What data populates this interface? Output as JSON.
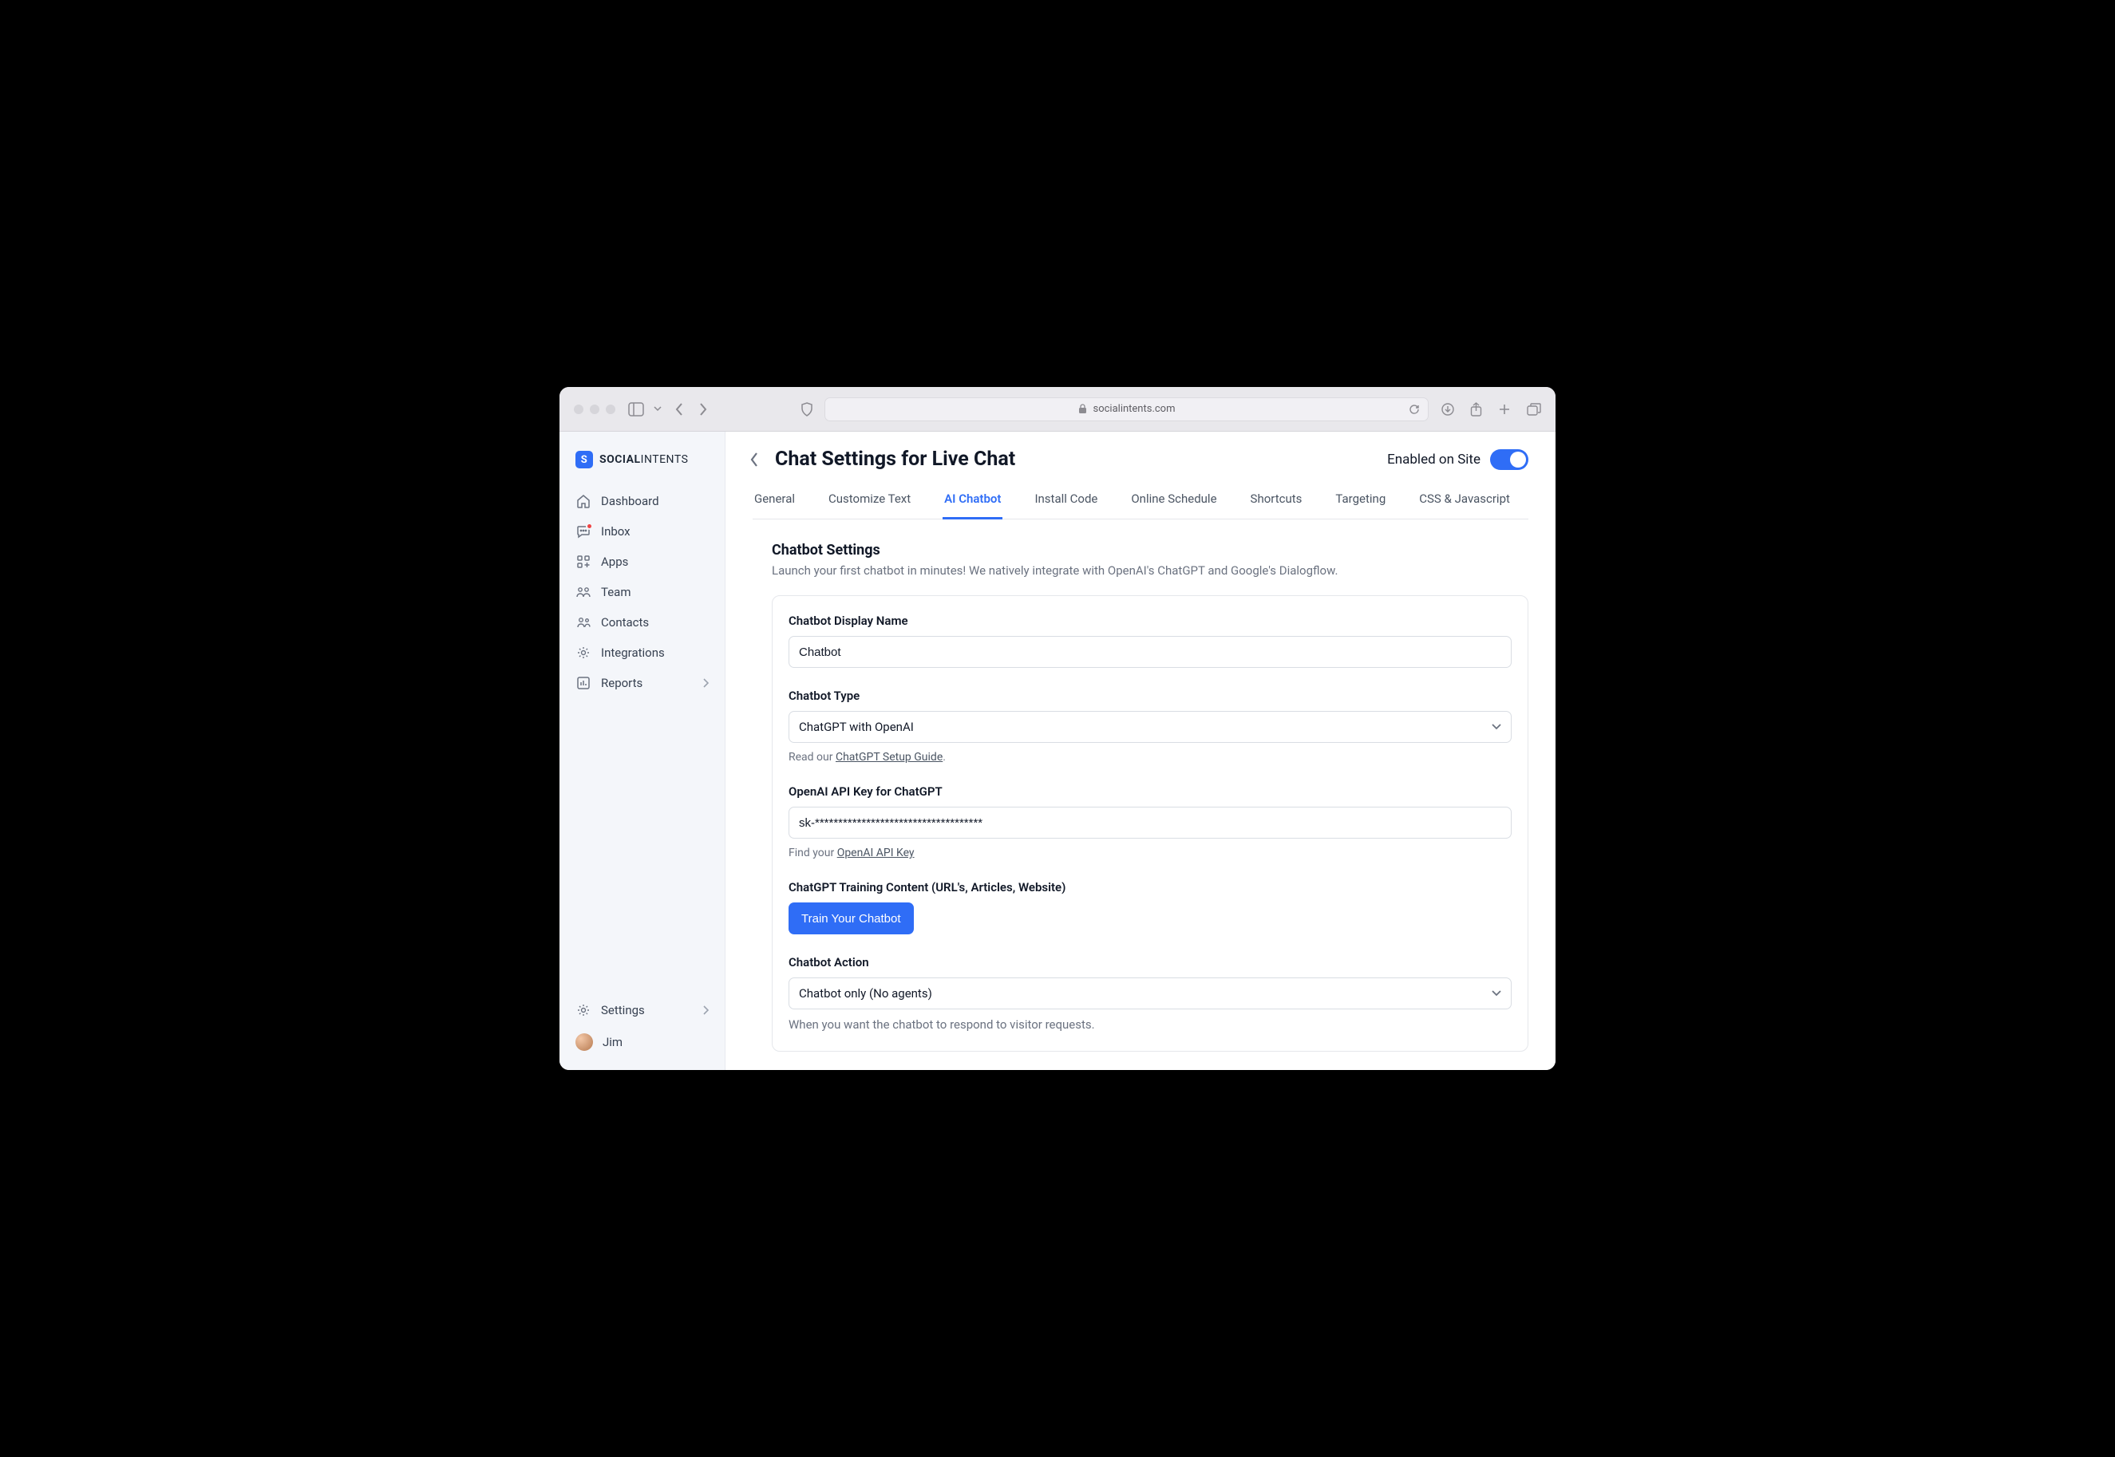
{
  "browser": {
    "url_host": "socialintents.com"
  },
  "brand": {
    "mark_letter": "S",
    "name_bold": "SOCIAL",
    "name_light": "INTENTS"
  },
  "sidebar": {
    "items": [
      {
        "label": "Dashboard"
      },
      {
        "label": "Inbox"
      },
      {
        "label": "Apps"
      },
      {
        "label": "Team"
      },
      {
        "label": "Contacts"
      },
      {
        "label": "Integrations"
      },
      {
        "label": "Reports"
      }
    ],
    "footer": {
      "settings_label": "Settings",
      "user_name": "Jim"
    }
  },
  "header": {
    "title": "Chat Settings for Live Chat",
    "enabled_label": "Enabled on Site"
  },
  "tabs": [
    {
      "label": "General"
    },
    {
      "label": "Customize Text"
    },
    {
      "label": "AI Chatbot",
      "active": true
    },
    {
      "label": "Install Code"
    },
    {
      "label": "Online Schedule"
    },
    {
      "label": "Shortcuts"
    },
    {
      "label": "Targeting"
    },
    {
      "label": "CSS & Javascript"
    }
  ],
  "settings": {
    "section_title": "Chatbot Settings",
    "section_desc": "Launch your first chatbot in minutes! We natively integrate with OpenAI's ChatGPT and Google's Dialogflow.",
    "display_name_label": "Chatbot Display Name",
    "display_name_value": "Chatbot",
    "type_label": "Chatbot Type",
    "type_value": "ChatGPT with OpenAI",
    "type_hint_prefix": "Read our ",
    "type_hint_link": "ChatGPT Setup Guide",
    "type_hint_suffix": ".",
    "api_key_label": "OpenAI API Key for ChatGPT",
    "api_key_value": "sk-************************************",
    "api_key_hint_prefix": "Find your ",
    "api_key_hint_link": "OpenAI API Key",
    "training_label": "ChatGPT Training Content (URL's, Articles, Website)",
    "train_button": "Train Your Chatbot",
    "action_label": "Chatbot Action",
    "action_value": "Chatbot only (No agents)",
    "action_hint": "When you want the chatbot to respond to visitor requests."
  }
}
